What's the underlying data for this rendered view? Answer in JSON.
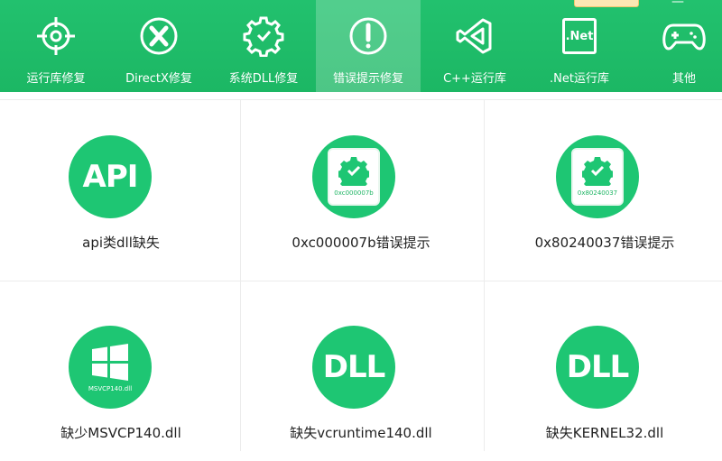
{
  "colors": {
    "brand_green": "#1ec673",
    "toolbar_green": "#20bf6b",
    "text_dark": "#222222"
  },
  "toolbar": {
    "active_tab_index": 3,
    "tabs": [
      {
        "label": "运行库修复",
        "icon": "target-icon"
      },
      {
        "label": "DirectX修复",
        "icon": "x-circle-icon"
      },
      {
        "label": "系统DLL修复",
        "icon": "gear-shield-icon"
      },
      {
        "label": "错误提示修复",
        "icon": "exclamation-circle-icon"
      },
      {
        "label": "C++运行库",
        "icon": "visual-studio-icon"
      },
      {
        "label": ".Net运行库",
        "icon": "dotnet-icon"
      },
      {
        "label": "其他",
        "icon": "gamepad-icon"
      }
    ],
    "dotnet_icon_text": ".Net"
  },
  "items": [
    {
      "label": "api类dll缺失",
      "icon": "api-icon",
      "icon_text": "API"
    },
    {
      "label": "0xc000007b错误提示",
      "icon": "error-code-icon",
      "icon_text": "0xc000007b"
    },
    {
      "label": "0x80240037错误提示",
      "icon": "error-code-icon",
      "icon_text": "0x80240037"
    },
    {
      "label": "缺少MSVCP140.dll",
      "icon": "windows-icon",
      "icon_text": "MSVCP140.dll"
    },
    {
      "label": "缺失vcruntime140.dll",
      "icon": "dll-icon",
      "icon_text": "DLL"
    },
    {
      "label": "缺失KERNEL32.dll",
      "icon": "dll-icon",
      "icon_text": "DLL"
    }
  ]
}
